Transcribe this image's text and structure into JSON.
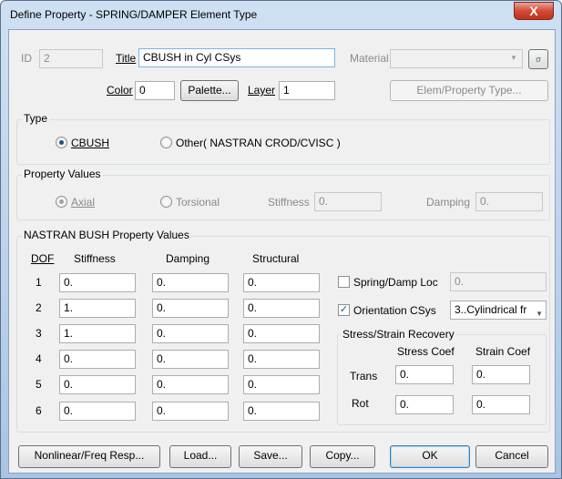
{
  "window": {
    "title": "Define Property - SPRING/DAMPER Element Type",
    "close_label": "X"
  },
  "header": {
    "id_label": "ID",
    "id_value": "2",
    "title_label": "Title",
    "title_value": "CBUSH in Cyl CSys",
    "material_label": "Material",
    "material_value": "",
    "color_label": "Color",
    "color_value": "0",
    "palette_label": "Palette...",
    "layer_label": "Layer",
    "layer_value": "1",
    "elem_type_label": "Elem/Property Type..."
  },
  "type_group": {
    "title": "Type",
    "cbush_label": "CBUSH",
    "cbush_selected": true,
    "other_label": "Other( NASTRAN CROD/CVISC )",
    "other_selected": false
  },
  "property_values": {
    "title": "Property Values",
    "axial_label": "Axial",
    "torsional_label": "Torsional",
    "stiffness_label": "Stiffness",
    "stiffness_value": "0.",
    "damping_label": "Damping",
    "damping_value": "0."
  },
  "bush": {
    "title": "NASTRAN BUSH Property Values",
    "headers": {
      "dof": "DOF",
      "stiffness": "Stiffness",
      "damping": "Damping",
      "structural": "Structural"
    },
    "rows": [
      {
        "dof": "1",
        "stiffness": "0.",
        "damping": "0.",
        "structural": "0."
      },
      {
        "dof": "2",
        "stiffness": "1.",
        "damping": "0.",
        "structural": "0."
      },
      {
        "dof": "3",
        "stiffness": "1.",
        "damping": "0.",
        "structural": "0."
      },
      {
        "dof": "4",
        "stiffness": "0.",
        "damping": "0.",
        "structural": "0."
      },
      {
        "dof": "5",
        "stiffness": "0.",
        "damping": "0.",
        "structural": "0."
      },
      {
        "dof": "6",
        "stiffness": "0.",
        "damping": "0.",
        "structural": "0."
      }
    ],
    "spring_damp_loc_label": "Spring/Damp Loc",
    "spring_damp_loc_checked": false,
    "spring_damp_loc_value": "0.",
    "orientation_label": "Orientation CSys",
    "orientation_checked": true,
    "orientation_value": "3..Cylindrical fr",
    "recovery": {
      "title": "Stress/Strain Recovery",
      "stress_coef_label": "Stress Coef",
      "strain_coef_label": "Strain Coef",
      "trans_label": "Trans",
      "trans_stress": "0.",
      "trans_strain": "0.",
      "rot_label": "Rot",
      "rot_stress": "0.",
      "rot_strain": "0."
    }
  },
  "footer": {
    "nonlinear_label": "Nonlinear/Freq Resp...",
    "load_label": "Load...",
    "save_label": "Save...",
    "copy_label": "Copy...",
    "ok_label": "OK",
    "cancel_label": "Cancel"
  }
}
